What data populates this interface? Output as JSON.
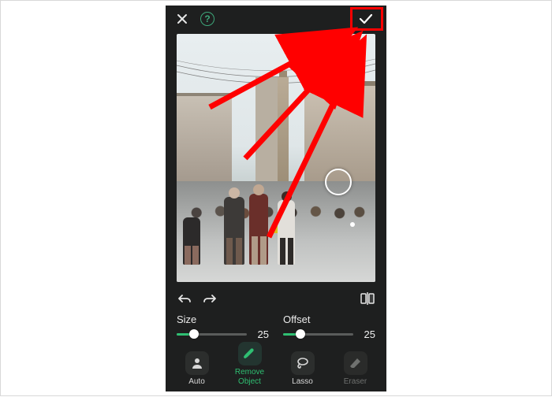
{
  "topbar": {
    "close_icon": "close-icon",
    "help_icon": "help-icon",
    "confirm_icon": "check-icon"
  },
  "canvas": {
    "brush_cursor": "brush-cursor"
  },
  "history": {
    "undo_icon": "undo-icon",
    "redo_icon": "redo-icon",
    "compare_icon": "compare-icon"
  },
  "sliders": {
    "size": {
      "label": "Size",
      "value": "25",
      "percent": 25
    },
    "offset": {
      "label": "Offset",
      "value": "25",
      "percent": 25
    }
  },
  "tools": [
    {
      "key": "auto",
      "label": "Auto",
      "label2": "",
      "icon": "person-auto-icon",
      "state": "normal"
    },
    {
      "key": "remove",
      "label": "Remove",
      "label2": "Object",
      "icon": "brush-icon",
      "state": "active"
    },
    {
      "key": "lasso",
      "label": "Lasso",
      "label2": "",
      "icon": "lasso-icon",
      "state": "normal"
    },
    {
      "key": "eraser",
      "label": "Eraser",
      "label2": "",
      "icon": "eraser-icon",
      "state": "disabled"
    }
  ],
  "annotation": {
    "highlight_target": "confirm-button",
    "color": "#ff0000"
  }
}
